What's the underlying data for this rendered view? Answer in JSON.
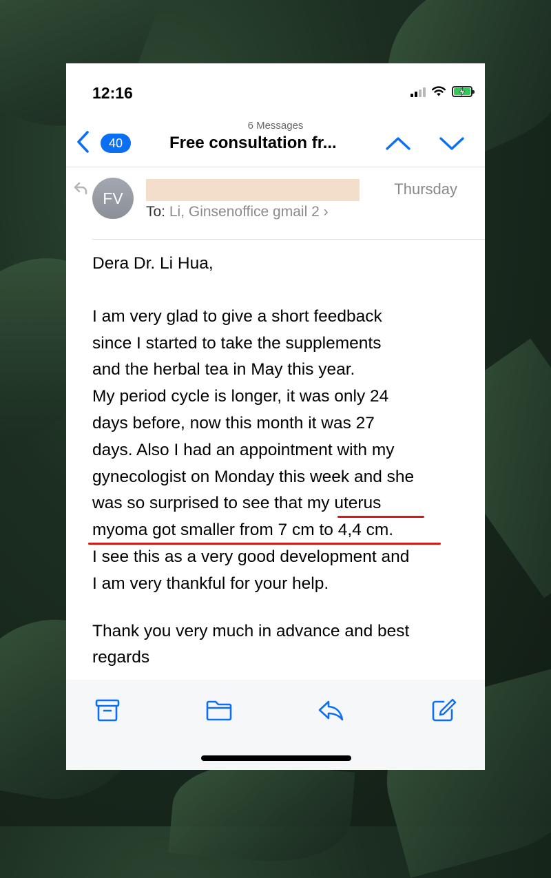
{
  "status_bar": {
    "time": "12:16"
  },
  "navbar": {
    "back_count": "40",
    "message_count": "6 Messages",
    "title": "Free consultation fr..."
  },
  "mail": {
    "avatar_initials": "FV",
    "date": "Thursday",
    "to_label": "To:",
    "recipients": "Li, Ginsenoffice gmail 2",
    "greeting": "Dera Dr. Li Hua,",
    "paragraph1_lines": [
      "I am very glad to give a short feedback",
      "since I started to take the supplements",
      "and the herbal tea in May this year.",
      "My period cycle is longer, it was only 24",
      "days before, now this month it was 27",
      "days. Also  I had an appointment with my",
      "gynecologist on Monday this week and she",
      "was so surprised to see that my uterus",
      "myoma got smaller from 7 cm to 4,4 cm.",
      "I see this as a very good development and",
      "I am very thankful for your help."
    ],
    "closing_lines": [
      "Thank you very much in advance and best",
      "regards"
    ]
  },
  "colors": {
    "accent": "#0a6ff3",
    "underline": "#d11a1a",
    "battery": "#34c759"
  },
  "icons": {
    "toolbar": [
      "archive-icon",
      "folder-icon",
      "reply-icon",
      "compose-icon"
    ]
  }
}
